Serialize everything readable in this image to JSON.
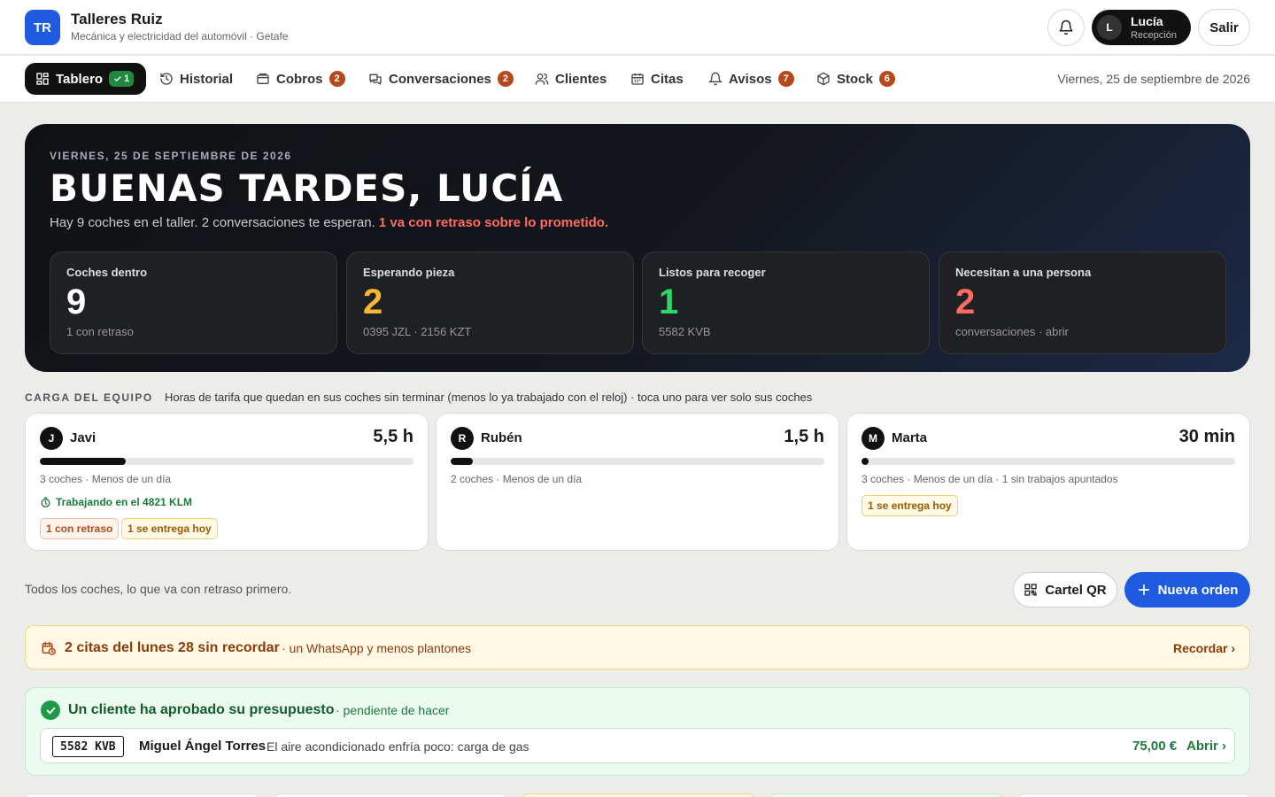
{
  "brand": {
    "initials": "TR",
    "name": "Talleres Ruiz",
    "subtitle": "Mecánica y electricidad del automóvil · Getafe"
  },
  "user": {
    "initial": "L",
    "name": "Lucía",
    "role": "Recepción",
    "logout_label": "Salir"
  },
  "tabs": [
    {
      "label": "Tablero",
      "badge": "1",
      "icon": "dashboard-icon",
      "active": true
    },
    {
      "label": "Historial",
      "badge": "",
      "icon": "history-icon"
    },
    {
      "label": "Cobros",
      "badge": "2",
      "icon": "wallet-icon"
    },
    {
      "label": "Conversaciones",
      "badge": "2",
      "icon": "chat-icon"
    },
    {
      "label": "Clientes",
      "badge": "",
      "icon": "users-icon"
    },
    {
      "label": "Citas",
      "badge": "",
      "icon": "calendar-icon"
    },
    {
      "label": "Avisos",
      "badge": "7",
      "icon": "bell-icon"
    },
    {
      "label": "Stock",
      "badge": "6",
      "icon": "box-icon"
    }
  ],
  "current_date": "Viernes, 25 de septiembre de 2026",
  "hero": {
    "eyebrow": "VIERNES, 25 DE SEPTIEMBRE DE 2026",
    "title": "BUENAS TARDES, LUCÍA",
    "subtitle": "Hay 9 coches en el taller. 2 conversaciones te esperan.",
    "alert": "1 va con retraso sobre lo prometido.",
    "stats": [
      {
        "label": "Coches dentro",
        "value": "9",
        "sub": "1 con retraso",
        "color": "#ffffff"
      },
      {
        "label": "Esperando pieza",
        "value": "2",
        "sub": "0395 JZL · 2156 KZT",
        "color": "#f7b733"
      },
      {
        "label": "Listos para recoger",
        "value": "1",
        "sub": "5582 KVB",
        "color": "#2fd46a"
      },
      {
        "label": "Necesitan a una persona",
        "value": "2",
        "sub": "conversaciones · abrir",
        "color": "#ff6b61"
      }
    ]
  },
  "team": {
    "label": "CARGA DEL EQUIPO",
    "hint": "Horas de tarifa que quedan en sus coches sin terminar (menos lo ya trabajado con el reloj) · toca uno para ver solo sus coches",
    "members": [
      {
        "initial": "J",
        "name": "Javi",
        "hours": "5,5 h",
        "load": 0.23,
        "info": "3 coches · Menos de un día",
        "working": "Trabajando en el 4821 KLM",
        "tags": [
          {
            "text": "1 con retraso",
            "kind": "red"
          },
          {
            "text": "1 se entrega hoy",
            "kind": "amber"
          }
        ]
      },
      {
        "initial": "R",
        "name": "Rubén",
        "hours": "1,5 h",
        "load": 0.06,
        "info": "2 coches · Menos de un día",
        "working": "",
        "tags": []
      },
      {
        "initial": "M",
        "name": "Marta",
        "hours": "30 min",
        "load": 0.02,
        "info": "3 coches · Menos de un día · 1 sin trabajos apuntados",
        "working": "",
        "tags": [
          {
            "text": "1 se entrega hoy",
            "kind": "amber"
          }
        ]
      }
    ]
  },
  "list_intro": "Todos los coches, lo que va con retraso primero.",
  "actions": {
    "qr_label": "Cartel QR",
    "new_order_label": "Nueva orden"
  },
  "reminder": {
    "title": "2 citas del lunes 28 sin recordar",
    "subtitle": "· un WhatsApp y menos plantones",
    "link": "Recordar ›"
  },
  "approved": {
    "title": "Un cliente ha aprobado su presupuesto",
    "subtitle": "· pendiente de hacer",
    "row": {
      "plate": "5582 KVB",
      "client": "Miguel Ángel Torres",
      "description": "El aire acondicionado enfría poco: carga de gas",
      "amount": "75,00 €",
      "link": "Abrir ›"
    }
  },
  "colors": {
    "accent": "#1f5be0",
    "alert": "#ff6b61",
    "badge": "#b6491c",
    "success": "#1f9a48"
  }
}
